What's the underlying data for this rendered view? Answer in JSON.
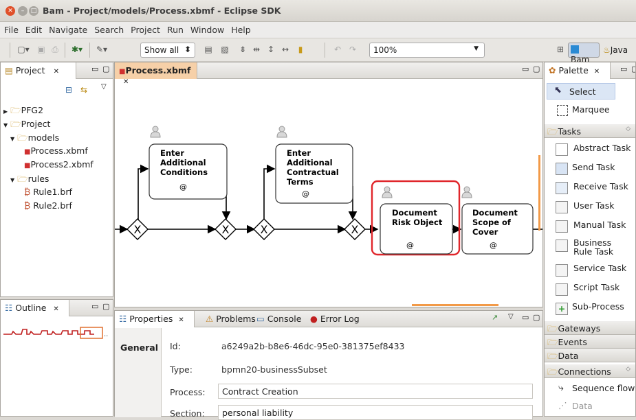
{
  "window": {
    "title": "Bam - Project/models/Process.xbmf - Eclipse SDK"
  },
  "menu": [
    "File",
    "Edit",
    "Navigate",
    "Search",
    "Project",
    "Run",
    "Window",
    "Help"
  ],
  "toolbar": {
    "show_select": "Show all",
    "zoom": "100%"
  },
  "perspectives": {
    "bam": "Bam",
    "java": "Java"
  },
  "project_view": {
    "tab": "Project",
    "tree": [
      {
        "label": "PFG2",
        "depth": 0,
        "type": "folder",
        "expanded": false
      },
      {
        "label": "Project",
        "depth": 0,
        "type": "folder",
        "expanded": true
      },
      {
        "label": "models",
        "depth": 1,
        "type": "folder",
        "expanded": true
      },
      {
        "label": "Process.xbmf",
        "depth": 2,
        "type": "model"
      },
      {
        "label": "Process2.xbmf",
        "depth": 2,
        "type": "model"
      },
      {
        "label": "rules",
        "depth": 1,
        "type": "folder",
        "expanded": true
      },
      {
        "label": "Rule1.brf",
        "depth": 2,
        "type": "rule"
      },
      {
        "label": "Rule2.brf",
        "depth": 2,
        "type": "rule"
      }
    ]
  },
  "outline_view": {
    "tab": "Outline"
  },
  "editor": {
    "tab": "Process.xbmf",
    "tasks": [
      {
        "lines": [
          "Enter",
          "Additional",
          "Conditions"
        ],
        "marker": "@"
      },
      {
        "lines": [
          "Enter",
          "Additional",
          "Contractual",
          "Terms"
        ],
        "marker": "@"
      },
      {
        "lines": [
          "Document",
          "Risk Object"
        ],
        "marker": "@",
        "selected": true
      },
      {
        "lines": [
          "Document",
          "Scope of",
          "Cover"
        ],
        "marker": "@"
      }
    ],
    "gateway_symbol": "X"
  },
  "palette": {
    "tab": "Palette",
    "tools": [
      {
        "label": "Select"
      },
      {
        "label": "Marquee"
      }
    ],
    "drawers": {
      "tasks": "Tasks",
      "task_items": [
        "Abstract Task",
        "Send Task",
        "Receive Task",
        "User Task",
        "Manual Task",
        "Business Rule Task",
        "Service Task",
        "Script Task",
        "Sub-Process"
      ],
      "gateways": "Gateways",
      "events": "Events",
      "data": "Data",
      "connections": "Connections",
      "connection_items": [
        "Sequence flow",
        "Data"
      ]
    }
  },
  "bottom": {
    "tabs": [
      "Properties",
      "Problems",
      "Console",
      "Error Log"
    ],
    "section_tab": "General",
    "fields": [
      {
        "label": "Id:",
        "value": "a6249a2b-b8e6-46dc-95e0-381375ef8433"
      },
      {
        "label": "Type:",
        "value": "bpmn20-businessSubset"
      },
      {
        "label": "Process:",
        "value": "Contract Creation"
      },
      {
        "label": "Section:",
        "value": "personal liability"
      }
    ]
  },
  "colors": {
    "selection": "#e0262b",
    "editor_tab": "#f6d0a8",
    "accent": "#f29a48"
  }
}
